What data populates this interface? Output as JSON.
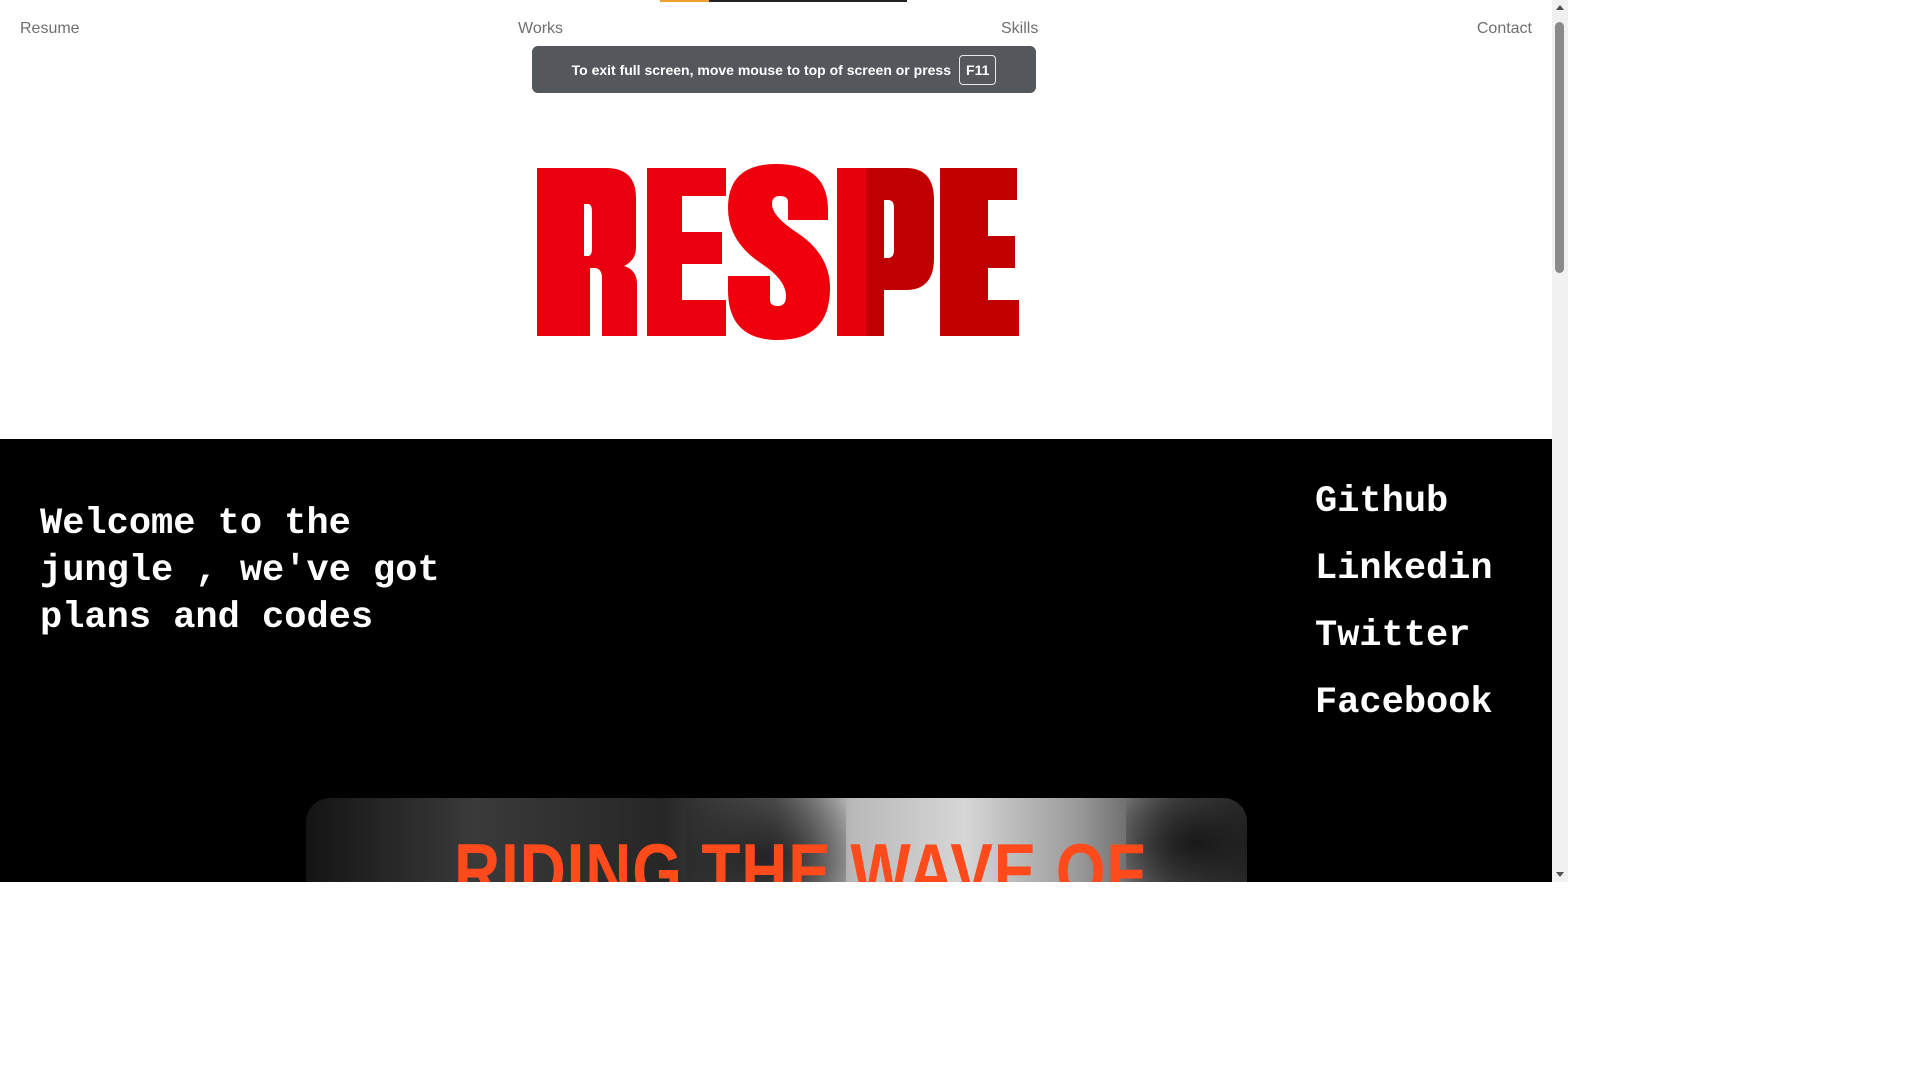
{
  "nav": {
    "resume": "Resume",
    "works": "Works",
    "skills": "Skills",
    "contact": "Contact"
  },
  "page_progress": 0.2,
  "fullscreen_toast": {
    "message": "To exit full screen, move mouse to top of screen or press",
    "key": "F11"
  },
  "hero": {
    "text": "RESPE",
    "colors": [
      "#e8000f",
      "#e8000f",
      "#f0000d",
      "#c00000",
      "#c20000"
    ]
  },
  "welcome": {
    "line1": "Welcome to the",
    "line2": "jungle , we've got",
    "line3": "plans and codes"
  },
  "socials": {
    "github": "Github",
    "linkedin": "Linkedin",
    "twitter": "Twitter",
    "facebook": "Facebook"
  },
  "banner": {
    "title": "RIDING THE WAVE OF"
  },
  "colors": {
    "accent_red": "#e8000f",
    "banner_orange": "#ff4a1c",
    "dark_bg": "#000000",
    "toast_bg": "#54585d",
    "nav_text": "#6f6f6f",
    "progress_fill": "#f0a030"
  }
}
